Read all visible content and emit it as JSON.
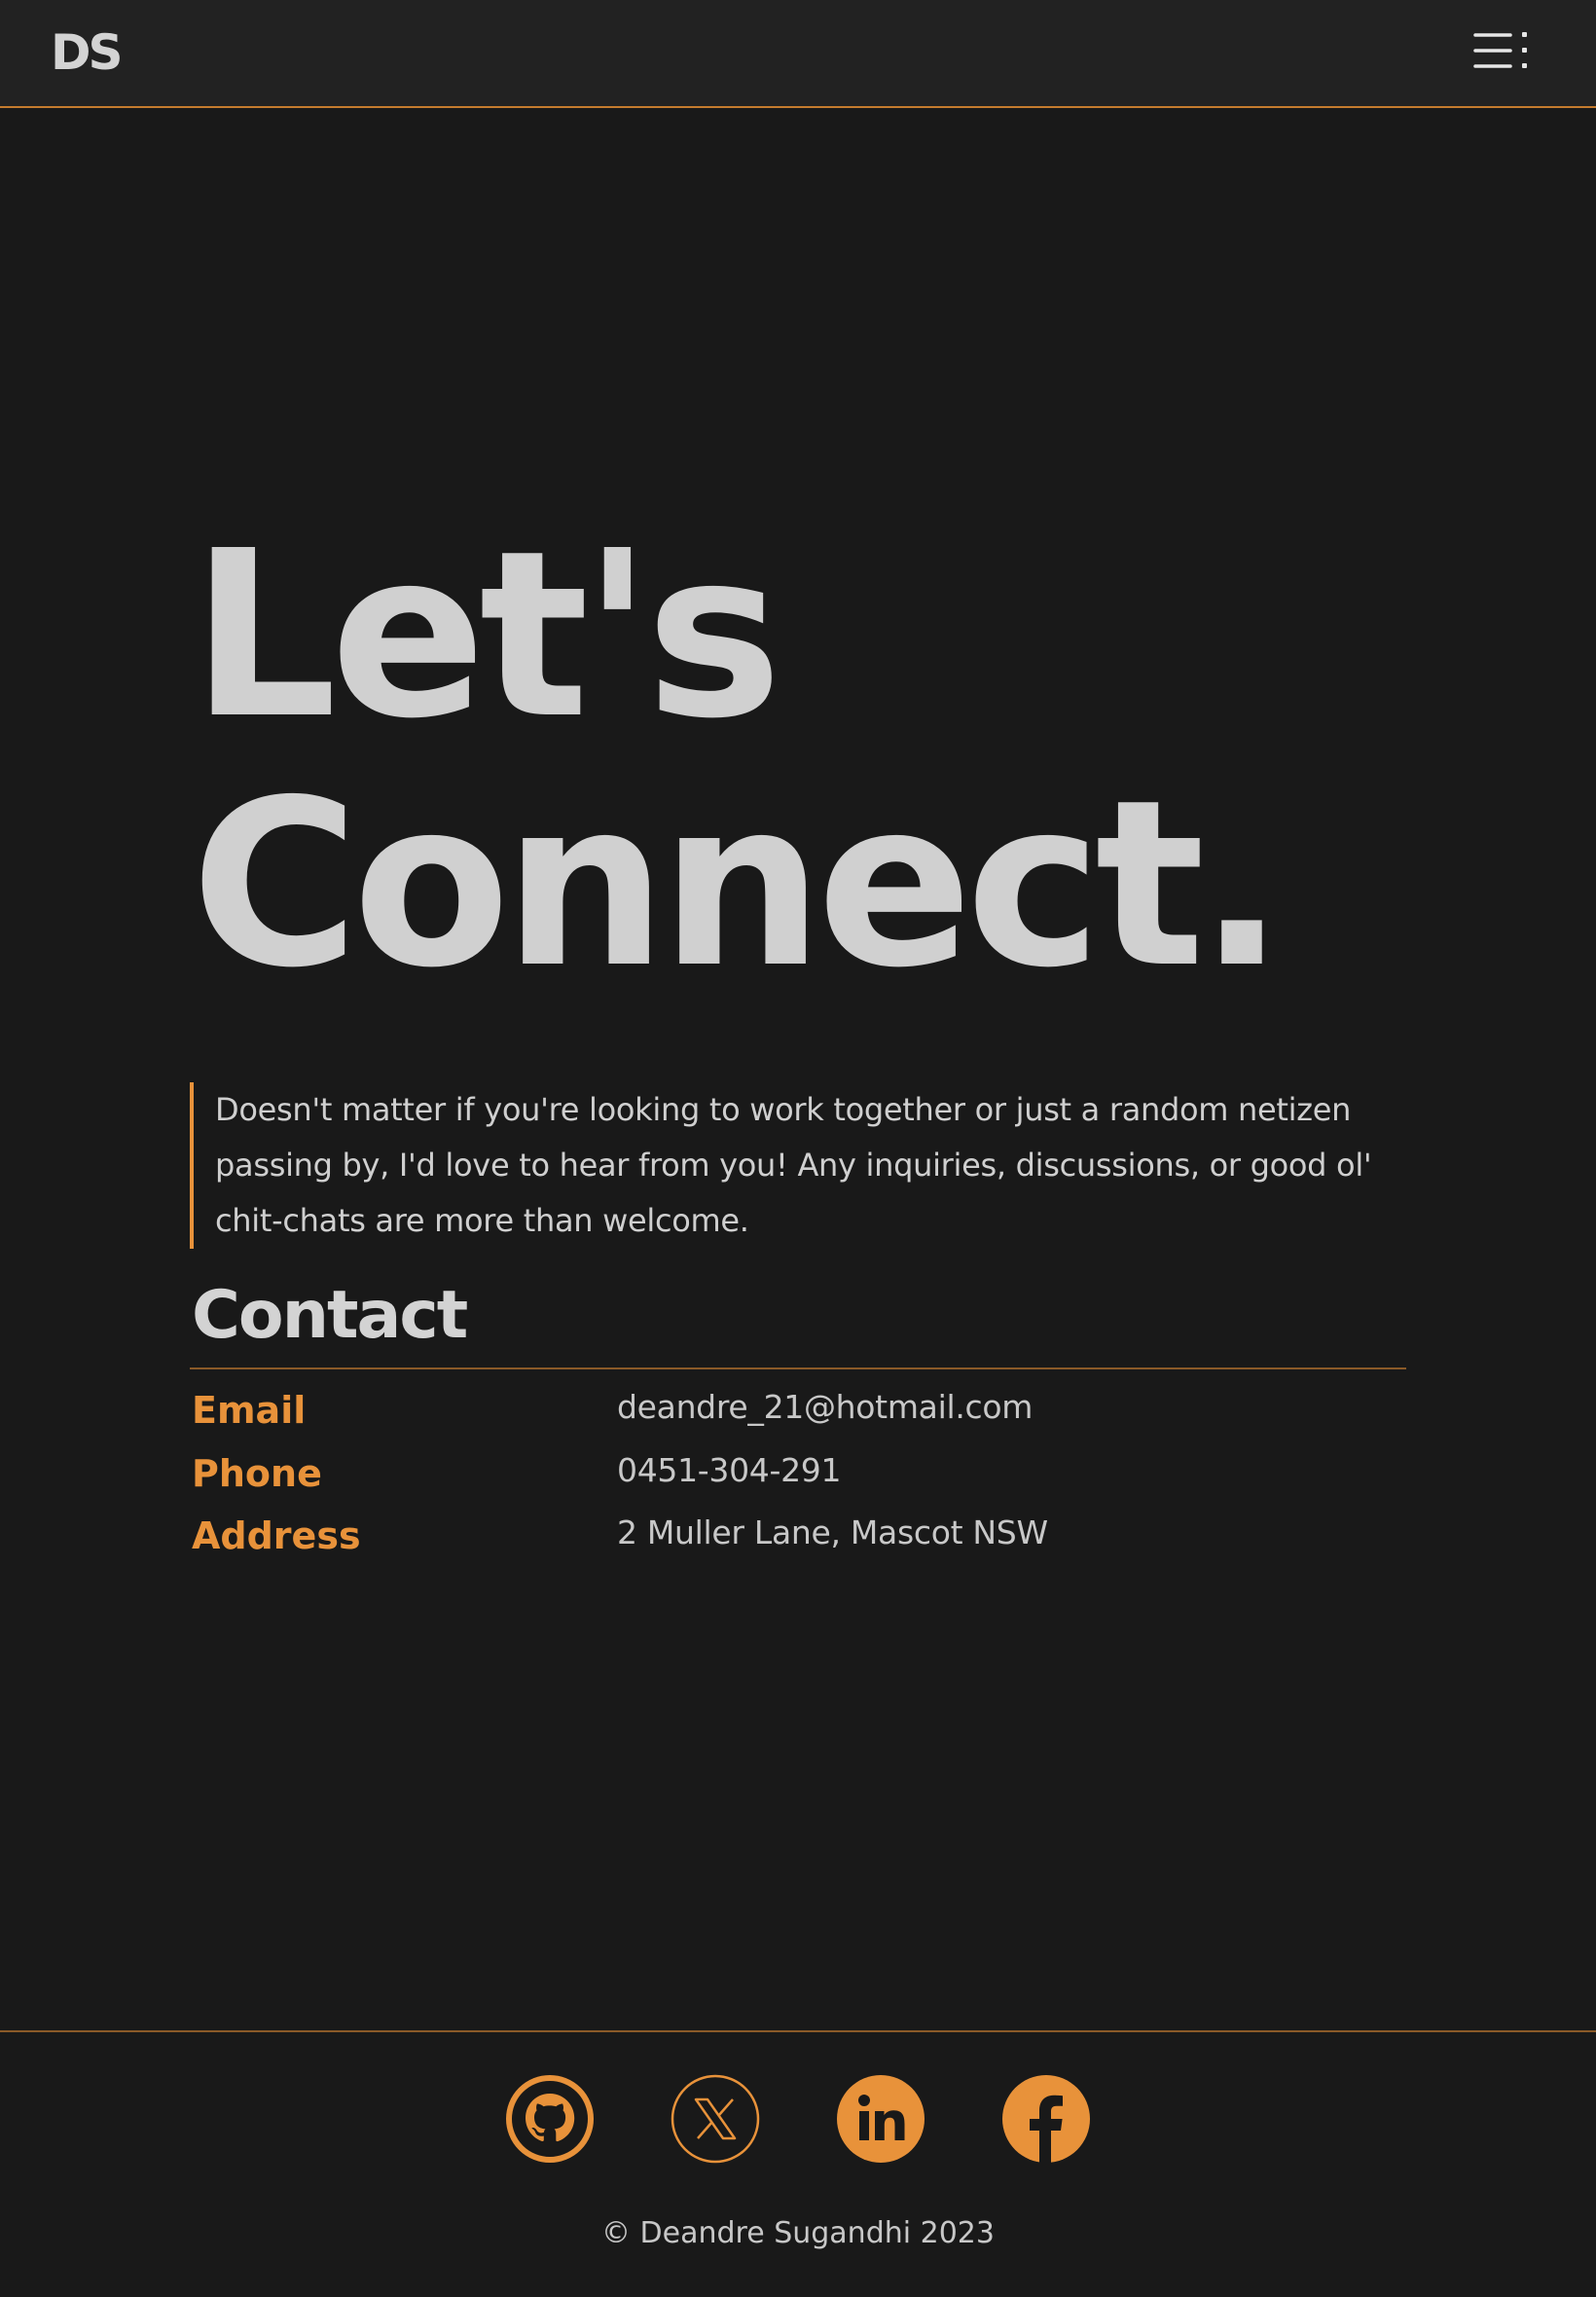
{
  "header": {
    "logo": "DS",
    "menu_icon": "menu-icon"
  },
  "hero": {
    "title_line1": "Let's",
    "title_line2": "Connect.",
    "intro": "Doesn't matter if you're looking to work together or just a random netizen passing by, I'd love to hear from you! Any inquiries, discussions, or good ol' chit-chats are more than welcome."
  },
  "contact": {
    "heading": "Contact",
    "rows": [
      {
        "label": "Email",
        "value": "deandre_21@hotmail.com"
      },
      {
        "label": "Phone",
        "value": "0451-304-291"
      },
      {
        "label": "Address",
        "value": "2 Muller Lane, Mascot NSW"
      }
    ]
  },
  "footer": {
    "social": [
      {
        "name": "github-icon"
      },
      {
        "name": "x-icon"
      },
      {
        "name": "linkedin-icon"
      },
      {
        "name": "facebook-icon"
      }
    ],
    "copyright": "© Deandre Sugandhi 2023"
  },
  "colors": {
    "background": "#191919",
    "header_bg": "#222222",
    "accent": "#e8923a",
    "text": "#d0d0d0"
  }
}
